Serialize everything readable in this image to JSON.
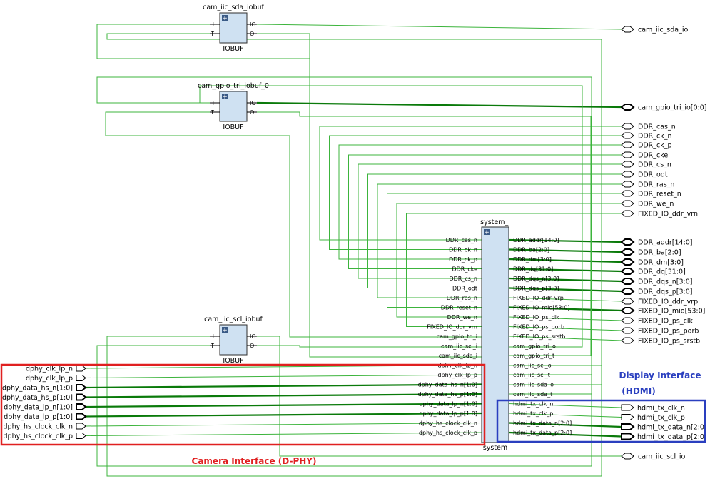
{
  "colors": {
    "wire": "#3cb43c",
    "bus": "#0a7a0a",
    "block_fill": "#cfe1f2",
    "block_stroke": "#2d2d2d",
    "camera_box": "#e02020",
    "display_box": "#2a3fbf",
    "display_text": "#2a3fbf",
    "camera_text": "#e02020"
  },
  "iobufs": [
    {
      "instance": "cam_iic_sda_iobuf",
      "type": "IOBUF",
      "pins_left": [
        "I",
        "T"
      ],
      "pins_right": [
        "IO",
        "O"
      ]
    },
    {
      "instance": "cam_gpio_tri_iobuf_0",
      "type": "IOBUF",
      "pins_left": [
        "I",
        "T"
      ],
      "pins_right": [
        "IO",
        "O"
      ]
    },
    {
      "instance": "cam_iic_scl_iobuf",
      "type": "IOBUF",
      "pins_left": [
        "I",
        "T"
      ],
      "pins_right": [
        "IO",
        "O"
      ]
    }
  ],
  "system": {
    "instance": "system_i",
    "type": "system",
    "pins_left": [
      "DDR_cas_n",
      "DDR_ck_n",
      "DDR_ck_p",
      "DDR_cke",
      "DDR_cs_n",
      "DDR_odt",
      "DDR_ras_n",
      "DDR_reset_n",
      "DDR_we_n",
      "FIXED_IO_ddr_vrn",
      "cam_gpio_tri_i",
      "cam_iic_scl_i",
      "cam_iic_sda_i",
      "dphy_clk_lp_n",
      "dphy_clk_lp_p",
      "dphy_data_hs_n[1:0]",
      "dphy_data_hs_p[1:0]",
      "dphy_data_lp_n[1:0]",
      "dphy_data_lp_p[1:0]",
      "dphy_hs_clock_clk_n",
      "dphy_hs_clock_clk_p"
    ],
    "pins_right": [
      "DDR_addr[14:0]",
      "DDR_ba[2:0]",
      "DDR_dm[3:0]",
      "DDR_dq[31:0]",
      "DDR_dqs_n[3:0]",
      "DDR_dqs_p[3:0]",
      "FIXED_IO_ddr_vrp",
      "FIXED_IO_mio[53:0]",
      "FIXED_IO_ps_clk",
      "FIXED_IO_ps_porb",
      "FIXED_IO_ps_srstb",
      "cam_gpio_tri_o",
      "cam_gpio_tri_t",
      "cam_iic_scl_o",
      "cam_iic_scl_t",
      "cam_iic_sda_o",
      "cam_iic_sda_t",
      "hdmi_tx_clk_n",
      "hdmi_tx_clk_p",
      "hdmi_tx_data_n[2:0]",
      "hdmi_tx_data_p[2:0]"
    ]
  },
  "top_ports_right": [
    "cam_iic_sda_io",
    "cam_gpio_tri_io[0:0]",
    "DDR_cas_n",
    "DDR_ck_n",
    "DDR_ck_p",
    "DDR_cke",
    "DDR_cs_n",
    "DDR_odt",
    "DDR_ras_n",
    "DDR_reset_n",
    "DDR_we_n",
    "FIXED_IO_ddr_vrn",
    "DDR_addr[14:0]",
    "DDR_ba[2:0]",
    "DDR_dm[3:0]",
    "DDR_dq[31:0]",
    "DDR_dqs_n[3:0]",
    "DDR_dqs_p[3:0]",
    "FIXED_IO_ddr_vrp",
    "FIXED_IO_mio[53:0]",
    "FIXED_IO_ps_clk",
    "FIXED_IO_ps_porb",
    "FIXED_IO_ps_srstb",
    "cam_iic_scl_io"
  ],
  "hdmi_ports": [
    "hdmi_tx_clk_n",
    "hdmi_tx_clk_p",
    "hdmi_tx_data_n[2:0]",
    "hdmi_tx_data_p[2:0]"
  ],
  "dphy_ports": [
    "dphy_clk_lp_n",
    "dphy_clk_lp_p",
    "dphy_data_hs_n[1:0]",
    "dphy_data_hs_p[1:0]",
    "dphy_data_lp_n[1:0]",
    "dphy_data_lp_p[1:0]",
    "dphy_hs_clock_clk_n",
    "dphy_hs_clock_clk_p"
  ],
  "annotations": {
    "display_line1": "Display Interface",
    "display_line2": "(HDMI)",
    "camera": "Camera Interface (D-PHY)"
  }
}
